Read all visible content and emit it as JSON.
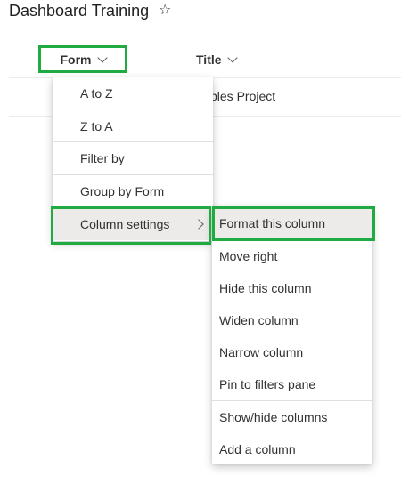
{
  "page": {
    "title": "Dashboard Training",
    "favorite_icon": "star-outline-icon"
  },
  "colors": {
    "highlight": "#1faa42",
    "menu_active_background": "#edebe9",
    "text": "#323130"
  },
  "columns": [
    {
      "label": "Form",
      "icon": "chevron-down-icon"
    },
    {
      "label": "Title",
      "icon": "chevron-down-icon"
    }
  ],
  "rows": [
    {
      "title_partial": "ples Project"
    }
  ],
  "column_menu": {
    "items": [
      {
        "label": "A to Z"
      },
      {
        "label": "Z to A"
      },
      {
        "label": "Filter by"
      },
      {
        "label": "Group by Form"
      },
      {
        "label": "Column settings",
        "has_submenu": true,
        "active": true
      }
    ]
  },
  "column_settings_submenu": {
    "items": [
      {
        "label": "Format this column",
        "active": true
      },
      {
        "label": "Move right"
      },
      {
        "label": "Hide this column"
      },
      {
        "label": "Widen column"
      },
      {
        "label": "Narrow column"
      },
      {
        "label": "Pin to filters pane"
      },
      {
        "label": "Show/hide columns"
      },
      {
        "label": "Add a column"
      }
    ]
  }
}
